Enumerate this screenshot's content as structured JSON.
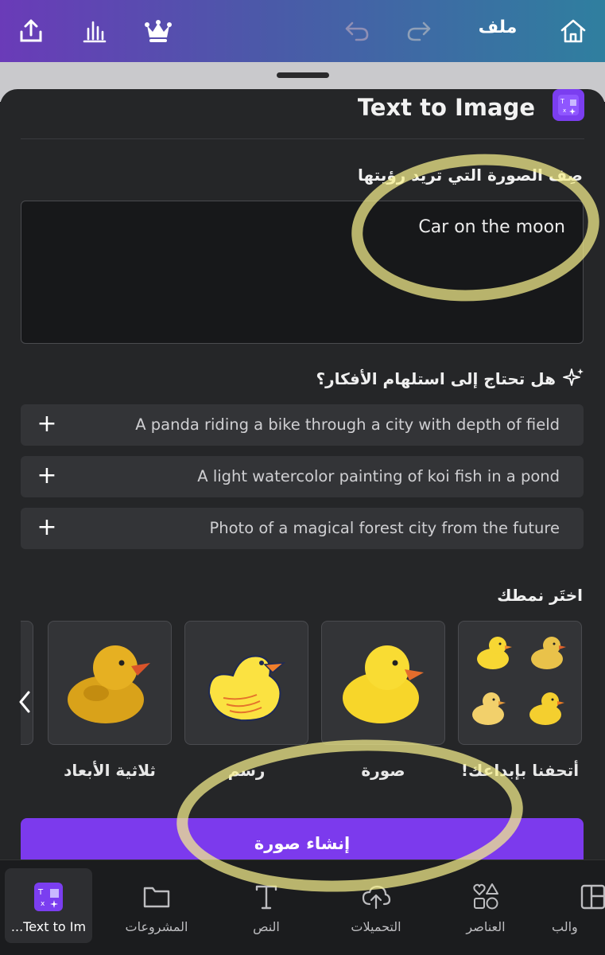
{
  "topbar": {
    "file_label": "ملف",
    "icons": [
      "home-icon",
      "redo-icon",
      "undo-icon",
      "crown-icon",
      "chart-icon",
      "share-icon"
    ]
  },
  "panel": {
    "title": "Text to Image",
    "prompt_label": "صِف الصورة التي تريد رؤيتها",
    "prompt_value": "Car on the moon",
    "inspire_label": "هل تحتاج إلى استلهام الأفكار؟",
    "suggestions": [
      "A panda riding a bike through a city with depth of field",
      "A light watercolor painting of koi fish in a pond",
      "Photo of a magical forest city from the future"
    ],
    "style_heading": "اختَر نمطك",
    "styles": [
      {
        "label": "أتحفنا بإبداعك!"
      },
      {
        "label": "صورة"
      },
      {
        "label": "رسم"
      },
      {
        "label": "ثلاثية الأبعاد"
      }
    ],
    "generate_label": "إنشاء صورة"
  },
  "bottom_nav": {
    "items": [
      {
        "label": "...Text to Im",
        "icon": "text-to-image-icon",
        "active": true
      },
      {
        "label": "المشروعات",
        "icon": "folder-icon"
      },
      {
        "label": "النص",
        "icon": "text-icon"
      },
      {
        "label": "التحميلات",
        "icon": "upload-cloud-icon"
      },
      {
        "label": "العناصر",
        "icon": "elements-icon"
      },
      {
        "label": "والب",
        "icon": "templates-icon"
      }
    ]
  },
  "colors": {
    "accent": "#7c3aed",
    "panel_bg": "#252628",
    "highlight": "#f6f08c"
  }
}
